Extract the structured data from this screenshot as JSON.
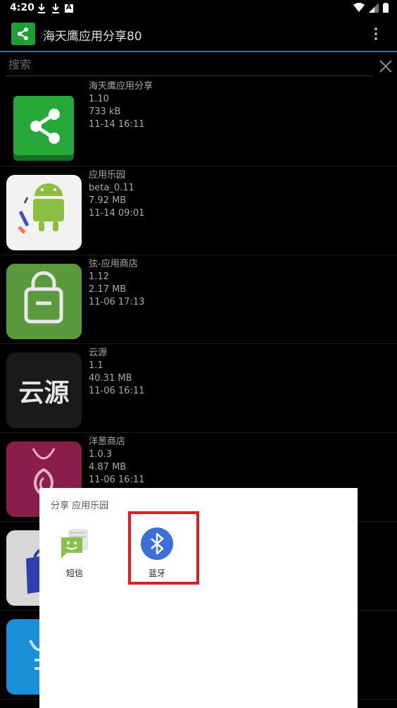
{
  "status_bar": {
    "time": "4:20"
  },
  "app_bar": {
    "title": "海天鹰应用分享80"
  },
  "search": {
    "placeholder": "搜索",
    "value": ""
  },
  "apps": [
    {
      "name": "海天鹰应用分享",
      "version": "1.10",
      "size": "733 kB",
      "date": "11-14 16:11",
      "icon": "share-app-icon"
    },
    {
      "name": "应用乐园",
      "version": "beta_0.11",
      "size": "7.92 MB",
      "date": "11-14 09:01",
      "icon": "android-rocket-icon"
    },
    {
      "name": "弦-应用商店",
      "version": "1.12",
      "size": "2.17 MB",
      "date": "11-06 17:13",
      "icon": "store-bag-icon"
    },
    {
      "name": "云源",
      "version": "1.1",
      "size": "40.31 MB",
      "date": "11-06 16:11",
      "icon": "yunyuan-icon",
      "icon_text": "云源"
    },
    {
      "name": "洋葱商店",
      "version": "1.0.3",
      "size": "4.87 MB",
      "date": "11-06 16:11",
      "icon": "onion-store-icon"
    },
    {
      "name": "",
      "version": "",
      "size": "",
      "date": "",
      "icon": "blue-bag-icon"
    },
    {
      "name": "",
      "version": "",
      "size": "",
      "date": "",
      "icon": "blue-app-icon"
    }
  ],
  "share_dialog": {
    "title": "分享 应用乐园",
    "targets": [
      {
        "label": "短信",
        "icon": "sms-icon"
      },
      {
        "label": "蓝牙",
        "icon": "bluetooth-icon"
      }
    ]
  },
  "colors": {
    "accent": "#2e6d9c",
    "highlight": "#e31b23",
    "bluetooth": "#3d6fd8",
    "sms": "#8bc34a"
  }
}
